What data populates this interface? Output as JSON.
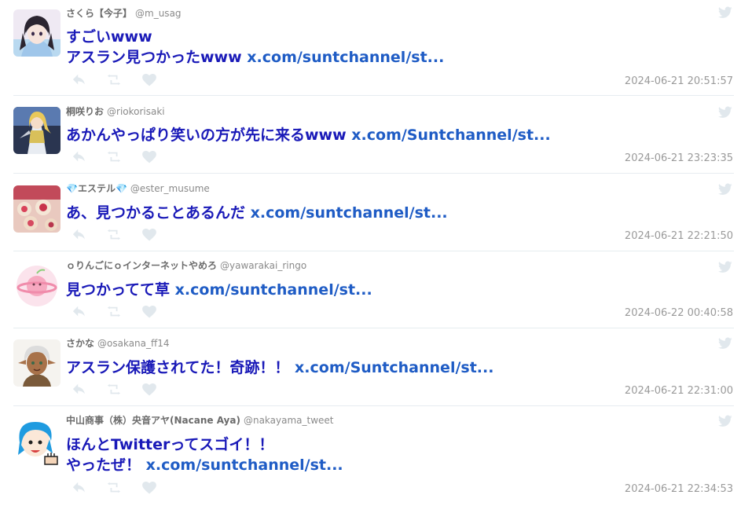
{
  "tweets": [
    {
      "name": "さくら【今子】",
      "handle": "@m_usag",
      "text_lines": [
        "すごいwww",
        "アスラン見つかったwww "
      ],
      "link": "x.com/suntchannel/st...",
      "timestamp": "2024-06-21 20:51:57",
      "avatar_icon": "avatar-anime-girl-icon"
    },
    {
      "name": "桐咲りお",
      "handle": "@riokorisaki",
      "text_lines": [
        "あかんやっぱり笑いの方が先に来るwww "
      ],
      "link": "x.com/Suntchannel/st...",
      "timestamp": "2024-06-21 23:23:35",
      "avatar_icon": "avatar-knight-icon"
    },
    {
      "name": "💎エステル💎",
      "handle": "@ester_musume",
      "text_lines": [
        "あ、見つかることあるんだ "
      ],
      "link": "x.com/suntchannel/st...",
      "timestamp": "2024-06-21 22:21:50",
      "avatar_icon": "avatar-sweets-icon"
    },
    {
      "name": "ｏりんごにｏインターネットやめろ",
      "handle": "@yawarakai_ringo",
      "text_lines": [
        "見つかってて草 "
      ],
      "link": "x.com/suntchannel/st...",
      "timestamp": "2024-06-22 00:40:58",
      "avatar_icon": "avatar-pink-planet-icon"
    },
    {
      "name": "さかな",
      "handle": "@osakana_ff14",
      "text_lines": [
        "アスラン保護されてた！奇跡！！ "
      ],
      "link": "x.com/Suntchannel/st...",
      "timestamp": "2024-06-21 22:31:00",
      "avatar_icon": "avatar-silver-hair-icon"
    },
    {
      "name": "中山商事（株）央音アヤ(Nacane Aya)",
      "handle": "@nakayama_tweet",
      "text_lines": [
        "ほんとTwitterってスゴイ！！",
        "やったぜ！ "
      ],
      "link": "x.com/suntchannel/st...",
      "timestamp": "2024-06-21 22:34:53",
      "avatar_icon": "avatar-blue-hair-icon"
    }
  ],
  "icons": {
    "reply": "reply-icon",
    "retweet": "retweet-icon",
    "like": "heart-icon",
    "source": "twitter-bird-icon"
  },
  "colors": {
    "tweet_text": "#1a1ab8",
    "link": "#1f5cc5",
    "meta": "#8a8a8a",
    "action_icon": "#e1e8ed",
    "divider": "#e6ecf0"
  }
}
